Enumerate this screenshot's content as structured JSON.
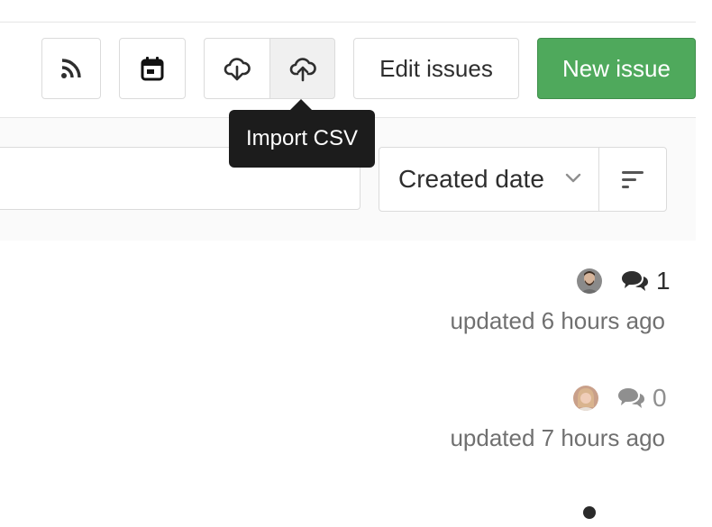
{
  "toolbar": {
    "rss_icon": "rss-icon",
    "calendar_icon": "calendar-icon",
    "export_icon": "cloud-download-icon",
    "import_icon": "cloud-upload-icon",
    "edit_issues_label": "Edit issues",
    "new_issue_label": "New issue",
    "new_issue_color": "#4fa95c"
  },
  "tooltip": {
    "text": "Import CSV"
  },
  "filter": {
    "sort_label": "Created date",
    "sort_dropdown_icon": "chevron-down-icon",
    "sort_direction_icon": "sort-lowest-icon"
  },
  "issues": [
    {
      "comment_count": "1",
      "updated": "updated 6 hours ago"
    },
    {
      "comment_count": "0",
      "updated": "updated 7 hours ago"
    }
  ]
}
